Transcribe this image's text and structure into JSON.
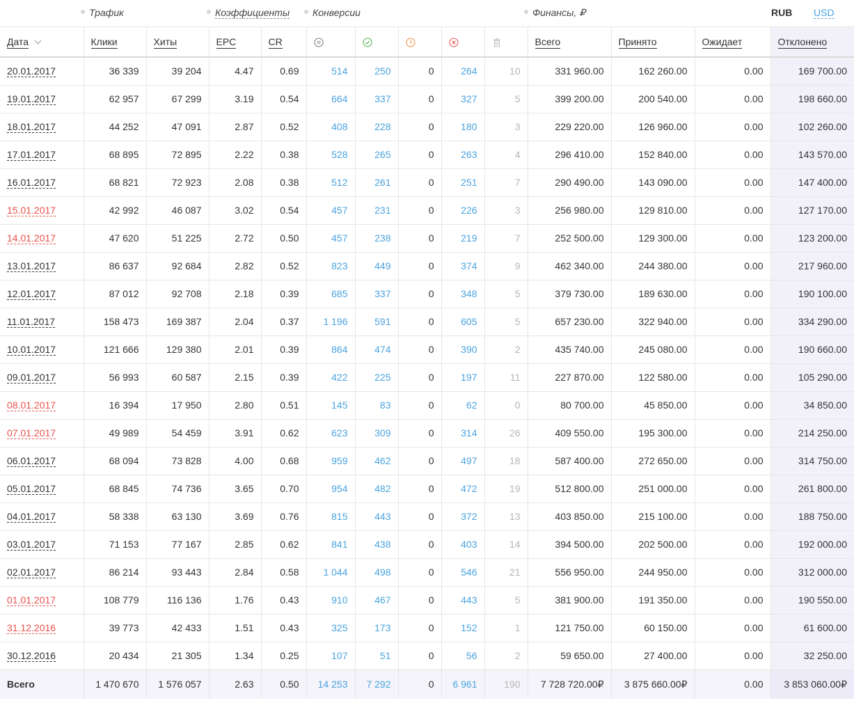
{
  "groups": {
    "traffic": "Трафик",
    "coefficients": "Коэффициенты",
    "conversions": "Конверсии",
    "finance": "Финансы, ₽"
  },
  "currency": {
    "rub": "RUB",
    "usd": "USD"
  },
  "columns": {
    "date": "Дата",
    "clicks": "Клики",
    "hits": "Хиты",
    "epc": "EPC",
    "cr": "CR",
    "total": "Всего",
    "accepted": "Принято",
    "pending": "Ожидает",
    "rejected": "Отклонено"
  },
  "conversion_icons": [
    "equals-circle-icon",
    "check-circle-icon",
    "clock-circle-icon",
    "x-circle-icon",
    "trash-icon"
  ],
  "colors": {
    "link_blue": "#4aa3df",
    "weekend_red": "#e8524a",
    "highlight": "#f2f1fa"
  },
  "rows": [
    {
      "date": "20.01.2017",
      "red": false,
      "clicks": "36 339",
      "hits": "39 204",
      "epc": "4.47",
      "cr": "0.69",
      "all": "514",
      "approved": "250",
      "hold": "0",
      "rejected": "264",
      "trash": "10",
      "total": "331 960.00",
      "accepted": "162 260.00",
      "pending": "0.00",
      "declined": "169 700.00"
    },
    {
      "date": "19.01.2017",
      "red": false,
      "clicks": "62 957",
      "hits": "67 299",
      "epc": "3.19",
      "cr": "0.54",
      "all": "664",
      "approved": "337",
      "hold": "0",
      "rejected": "327",
      "trash": "5",
      "total": "399 200.00",
      "accepted": "200 540.00",
      "pending": "0.00",
      "declined": "198 660.00"
    },
    {
      "date": "18.01.2017",
      "red": false,
      "clicks": "44 252",
      "hits": "47 091",
      "epc": "2.87",
      "cr": "0.52",
      "all": "408",
      "approved": "228",
      "hold": "0",
      "rejected": "180",
      "trash": "3",
      "total": "229 220.00",
      "accepted": "126 960.00",
      "pending": "0.00",
      "declined": "102 260.00"
    },
    {
      "date": "17.01.2017",
      "red": false,
      "clicks": "68 895",
      "hits": "72 895",
      "epc": "2.22",
      "cr": "0.38",
      "all": "528",
      "approved": "265",
      "hold": "0",
      "rejected": "263",
      "trash": "4",
      "total": "296 410.00",
      "accepted": "152 840.00",
      "pending": "0.00",
      "declined": "143 570.00"
    },
    {
      "date": "16.01.2017",
      "red": false,
      "clicks": "68 821",
      "hits": "72 923",
      "epc": "2.08",
      "cr": "0.38",
      "all": "512",
      "approved": "261",
      "hold": "0",
      "rejected": "251",
      "trash": "7",
      "total": "290 490.00",
      "accepted": "143 090.00",
      "pending": "0.00",
      "declined": "147 400.00"
    },
    {
      "date": "15.01.2017",
      "red": true,
      "clicks": "42 992",
      "hits": "46 087",
      "epc": "3.02",
      "cr": "0.54",
      "all": "457",
      "approved": "231",
      "hold": "0",
      "rejected": "226",
      "trash": "3",
      "total": "256 980.00",
      "accepted": "129 810.00",
      "pending": "0.00",
      "declined": "127 170.00"
    },
    {
      "date": "14.01.2017",
      "red": true,
      "clicks": "47 620",
      "hits": "51 225",
      "epc": "2.72",
      "cr": "0.50",
      "all": "457",
      "approved": "238",
      "hold": "0",
      "rejected": "219",
      "trash": "7",
      "total": "252 500.00",
      "accepted": "129 300.00",
      "pending": "0.00",
      "declined": "123 200.00"
    },
    {
      "date": "13.01.2017",
      "red": false,
      "clicks": "86 637",
      "hits": "92 684",
      "epc": "2.82",
      "cr": "0.52",
      "all": "823",
      "approved": "449",
      "hold": "0",
      "rejected": "374",
      "trash": "9",
      "total": "462 340.00",
      "accepted": "244 380.00",
      "pending": "0.00",
      "declined": "217 960.00"
    },
    {
      "date": "12.01.2017",
      "red": false,
      "clicks": "87 012",
      "hits": "92 708",
      "epc": "2.18",
      "cr": "0.39",
      "all": "685",
      "approved": "337",
      "hold": "0",
      "rejected": "348",
      "trash": "5",
      "total": "379 730.00",
      "accepted": "189 630.00",
      "pending": "0.00",
      "declined": "190 100.00"
    },
    {
      "date": "11.01.2017",
      "red": false,
      "clicks": "158 473",
      "hits": "169 387",
      "epc": "2.04",
      "cr": "0.37",
      "all": "1 196",
      "approved": "591",
      "hold": "0",
      "rejected": "605",
      "trash": "5",
      "total": "657 230.00",
      "accepted": "322 940.00",
      "pending": "0.00",
      "declined": "334 290.00"
    },
    {
      "date": "10.01.2017",
      "red": false,
      "clicks": "121 666",
      "hits": "129 380",
      "epc": "2.01",
      "cr": "0.39",
      "all": "864",
      "approved": "474",
      "hold": "0",
      "rejected": "390",
      "trash": "2",
      "total": "435 740.00",
      "accepted": "245 080.00",
      "pending": "0.00",
      "declined": "190 660.00"
    },
    {
      "date": "09.01.2017",
      "red": false,
      "clicks": "56 993",
      "hits": "60 587",
      "epc": "2.15",
      "cr": "0.39",
      "all": "422",
      "approved": "225",
      "hold": "0",
      "rejected": "197",
      "trash": "11",
      "total": "227 870.00",
      "accepted": "122 580.00",
      "pending": "0.00",
      "declined": "105 290.00"
    },
    {
      "date": "08.01.2017",
      "red": true,
      "clicks": "16 394",
      "hits": "17 950",
      "epc": "2.80",
      "cr": "0.51",
      "all": "145",
      "approved": "83",
      "hold": "0",
      "rejected": "62",
      "trash": "0",
      "total": "80 700.00",
      "accepted": "45 850.00",
      "pending": "0.00",
      "declined": "34 850.00"
    },
    {
      "date": "07.01.2017",
      "red": true,
      "clicks": "49 989",
      "hits": "54 459",
      "epc": "3.91",
      "cr": "0.62",
      "all": "623",
      "approved": "309",
      "hold": "0",
      "rejected": "314",
      "trash": "26",
      "total": "409 550.00",
      "accepted": "195 300.00",
      "pending": "0.00",
      "declined": "214 250.00"
    },
    {
      "date": "06.01.2017",
      "red": false,
      "clicks": "68 094",
      "hits": "73 828",
      "epc": "4.00",
      "cr": "0.68",
      "all": "959",
      "approved": "462",
      "hold": "0",
      "rejected": "497",
      "trash": "18",
      "total": "587 400.00",
      "accepted": "272 650.00",
      "pending": "0.00",
      "declined": "314 750.00"
    },
    {
      "date": "05.01.2017",
      "red": false,
      "clicks": "68 845",
      "hits": "74 736",
      "epc": "3.65",
      "cr": "0.70",
      "all": "954",
      "approved": "482",
      "hold": "0",
      "rejected": "472",
      "trash": "19",
      "total": "512 800.00",
      "accepted": "251 000.00",
      "pending": "0.00",
      "declined": "261 800.00"
    },
    {
      "date": "04.01.2017",
      "red": false,
      "clicks": "58 338",
      "hits": "63 130",
      "epc": "3.69",
      "cr": "0.76",
      "all": "815",
      "approved": "443",
      "hold": "0",
      "rejected": "372",
      "trash": "13",
      "total": "403 850.00",
      "accepted": "215 100.00",
      "pending": "0.00",
      "declined": "188 750.00"
    },
    {
      "date": "03.01.2017",
      "red": false,
      "clicks": "71 153",
      "hits": "77 167",
      "epc": "2.85",
      "cr": "0.62",
      "all": "841",
      "approved": "438",
      "hold": "0",
      "rejected": "403",
      "trash": "14",
      "total": "394 500.00",
      "accepted": "202 500.00",
      "pending": "0.00",
      "declined": "192 000.00"
    },
    {
      "date": "02.01.2017",
      "red": false,
      "clicks": "86 214",
      "hits": "93 443",
      "epc": "2.84",
      "cr": "0.58",
      "all": "1 044",
      "approved": "498",
      "hold": "0",
      "rejected": "546",
      "trash": "21",
      "total": "556 950.00",
      "accepted": "244 950.00",
      "pending": "0.00",
      "declined": "312 000.00"
    },
    {
      "date": "01.01.2017",
      "red": true,
      "clicks": "108 779",
      "hits": "116 136",
      "epc": "1.76",
      "cr": "0.43",
      "all": "910",
      "approved": "467",
      "hold": "0",
      "rejected": "443",
      "trash": "5",
      "total": "381 900.00",
      "accepted": "191 350.00",
      "pending": "0.00",
      "declined": "190 550.00"
    },
    {
      "date": "31.12.2016",
      "red": true,
      "clicks": "39 773",
      "hits": "42 433",
      "epc": "1.51",
      "cr": "0.43",
      "all": "325",
      "approved": "173",
      "hold": "0",
      "rejected": "152",
      "trash": "1",
      "total": "121 750.00",
      "accepted": "60 150.00",
      "pending": "0.00",
      "declined": "61 600.00"
    },
    {
      "date": "30.12.2016",
      "red": false,
      "clicks": "20 434",
      "hits": "21 305",
      "epc": "1.34",
      "cr": "0.25",
      "all": "107",
      "approved": "51",
      "hold": "0",
      "rejected": "56",
      "trash": "2",
      "total": "59 650.00",
      "accepted": "27 400.00",
      "pending": "0.00",
      "declined": "32 250.00"
    }
  ],
  "totals": {
    "label": "Всего",
    "clicks": "1 470 670",
    "hits": "1 576 057",
    "epc": "2.63",
    "cr": "0.50",
    "all": "14 253",
    "approved": "7 292",
    "hold": "0",
    "rejected": "6 961",
    "trash": "190",
    "total": "7 728 720.00₽",
    "accepted": "3 875 660.00₽",
    "pending": "0.00",
    "declined": "3 853 060.00₽"
  }
}
